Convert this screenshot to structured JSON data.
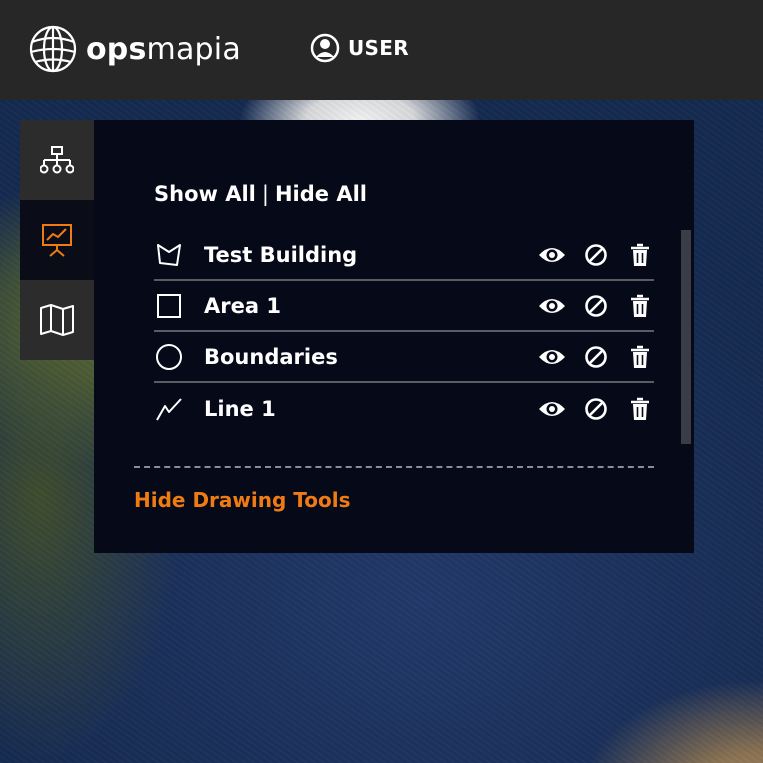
{
  "header": {
    "logo_bold": "ops",
    "logo_light": "mapia",
    "user_label": "USER"
  },
  "sidebar": {
    "tabs": [
      {
        "name": "hierarchy",
        "icon": "sitemap-icon",
        "active": false
      },
      {
        "name": "drawings",
        "icon": "presentation-chart-icon",
        "active": true
      },
      {
        "name": "maps",
        "icon": "folded-map-icon",
        "active": false
      }
    ]
  },
  "panel": {
    "show_all": "Show All",
    "separator": "|",
    "hide_all": "Hide All",
    "items": [
      {
        "label": "Test Building",
        "icon": "polygon-icon"
      },
      {
        "label": "Area 1",
        "icon": "square-icon"
      },
      {
        "label": "Boundaries",
        "icon": "circle-icon"
      },
      {
        "label": "Line 1",
        "icon": "polyline-icon"
      }
    ],
    "hide_drawing_tools": "Hide Drawing Tools"
  },
  "colors": {
    "accent": "#f07b13",
    "header_bg": "#272727",
    "panel_bg": "#050918"
  }
}
